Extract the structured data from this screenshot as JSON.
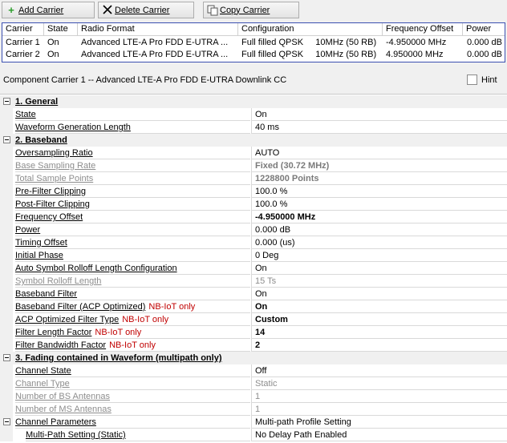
{
  "toolbar": {
    "add_label": "Add Carrier",
    "delete_label": "Delete Carrier",
    "copy_label": "Copy Carrier"
  },
  "carrier_table": {
    "headers": [
      "Carrier",
      "State",
      "Radio Format",
      "Configuration",
      "Frequency Offset",
      "Power"
    ],
    "rows": [
      [
        "Carrier 1",
        "On",
        "Advanced LTE-A Pro FDD E-UTRA ...",
        "Full filled QPSK     10MHz (50 RB)",
        "-4.950000 MHz",
        "0.000 dB"
      ],
      [
        "Carrier 2",
        "On",
        "Advanced LTE-A Pro FDD E-UTRA ...",
        "Full filled QPSK     10MHz (50 RB)",
        "4.950000 MHz",
        "0.000 dB"
      ]
    ]
  },
  "component": {
    "title": "Component Carrier 1 -- Advanced LTE-A Pro FDD E-UTRA Downlink CC",
    "hint_label": "Hint"
  },
  "sections": {
    "general": "1. General",
    "baseband": "2. Baseband",
    "fading": "3. Fading contained in Waveform (multipath only)"
  },
  "props": {
    "state": {
      "name": "State",
      "value": "On"
    },
    "wgl": {
      "name": "Waveform Generation Length",
      "value": "40 ms"
    },
    "osr": {
      "name": "Oversampling Ratio",
      "value": "AUTO"
    },
    "bsr": {
      "name": "Base Sampling Rate",
      "value": "Fixed (30.72 MHz)"
    },
    "tsp": {
      "name": "Total Sample Points",
      "value": "1228800 Points"
    },
    "prefilter": {
      "name": "Pre-Filter Clipping",
      "value": "100.0 %"
    },
    "postfilter": {
      "name": "Post-Filter Clipping",
      "value": "100.0 %"
    },
    "freq": {
      "name": "Frequency Offset",
      "value": "-4.950000 MHz"
    },
    "power": {
      "name": "Power",
      "value": "0.000 dB"
    },
    "timing": {
      "name": "Timing Offset",
      "value": "0.000 (us)"
    },
    "phase": {
      "name": "Initial Phase",
      "value": "0 Deg"
    },
    "asrl": {
      "name": "Auto Symbol Rolloff Length Configuration",
      "value": "On"
    },
    "srl": {
      "name": "Symbol Rolloff Length",
      "value": "15 Ts"
    },
    "bbf": {
      "name": "Baseband Filter",
      "value": "On"
    },
    "bbfacp": {
      "name": "Baseband Filter (ACP Optimized)",
      "note": "NB-IoT only",
      "value": "On"
    },
    "acpft": {
      "name": "ACP Optimized Filter Type",
      "note": "NB-IoT only",
      "value": "Custom"
    },
    "flf": {
      "name": "Filter Length Factor",
      "note": "NB-IoT only",
      "value": "14"
    },
    "fbf": {
      "name": "Filter Bandwidth Factor",
      "note": "NB-IoT only",
      "value": "2"
    },
    "chstate": {
      "name": "Channel State",
      "value": "Off"
    },
    "chtype": {
      "name": "Channel Type",
      "value": "Static"
    },
    "bsant": {
      "name": "Number of BS Antennas",
      "value": "1"
    },
    "msant": {
      "name": "Number of MS Antennas",
      "value": "1"
    },
    "chparams": {
      "name": "Channel Parameters",
      "value": "Multi-path Profile Setting"
    },
    "mps": {
      "name": "Multi-Path Setting (Static)",
      "value": "No Delay Path Enabled"
    }
  },
  "colors": {
    "note_red": "#c00000",
    "table_border": "#3b4fb0",
    "add_icon_green": "#2a9d2a"
  }
}
